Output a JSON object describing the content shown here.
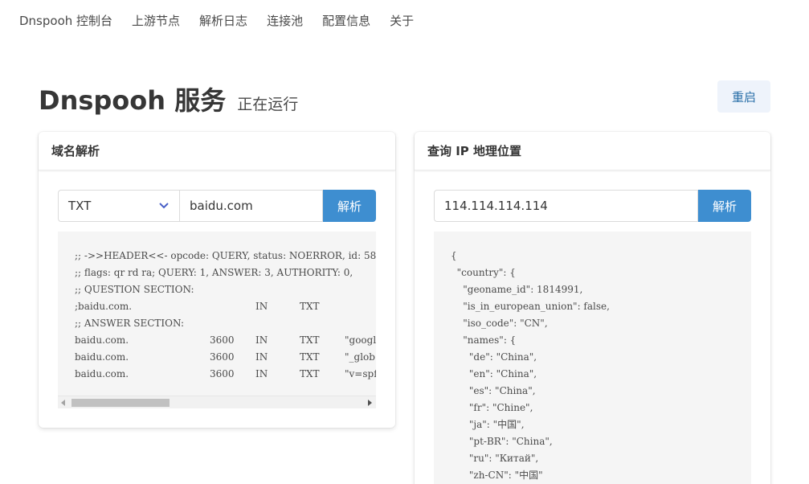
{
  "nav": {
    "items": [
      "Dnspooh 控制台",
      "上游节点",
      "解析日志",
      "连接池",
      "配置信息",
      "关于"
    ]
  },
  "header": {
    "title": "Dnspooh 服务",
    "status": "正在运行",
    "restart_label": "重启"
  },
  "dns_card": {
    "title": "域名解析",
    "record_type": "TXT",
    "domain_value": "baidu.com",
    "resolve_label": "解析",
    "lines": [
      [
        ";; ->>HEADER<<- opcode: QUERY, status: NOERROR, id: 58"
      ],
      [
        ";; flags: qr rd ra; QUERY: 1, ANSWER: 3, AUTHORITY: 0,"
      ],
      [
        ";; QUESTION SECTION:"
      ],
      [
        ";baidu.com.",
        "",
        "IN",
        "TXT",
        ""
      ],
      [
        ";; ANSWER SECTION:"
      ],
      [
        "baidu.com.",
        "3600",
        "IN",
        "TXT",
        "\"googl"
      ],
      [
        "baidu.com.",
        "3600",
        "IN",
        "TXT",
        "\"_glob"
      ],
      [
        "baidu.com.",
        "3600",
        "IN",
        "TXT",
        "\"v=spf"
      ]
    ]
  },
  "ip_card": {
    "title": "查询 IP 地理位置",
    "ip_value": "114.114.114.114",
    "resolve_label": "解析",
    "json_lines": [
      "{",
      "  \"country\": {",
      "    \"geoname_id\": 1814991,",
      "    \"is_in_european_union\": false,",
      "    \"iso_code\": \"CN\",",
      "    \"names\": {",
      "      \"de\": \"China\",",
      "      \"en\": \"China\",",
      "      \"es\": \"China\",",
      "      \"fr\": \"Chine\",",
      "      \"ja\": \"中国\",",
      "      \"pt-BR\": \"China\",",
      "      \"ru\": \"Китай\",",
      "      \"zh-CN\": \"中国\""
    ]
  },
  "colors": {
    "primary": "#3e8ed0",
    "restart_bg": "#eef3fb",
    "restart_text": "#296fa8",
    "code_bg": "#f5f5f5"
  }
}
